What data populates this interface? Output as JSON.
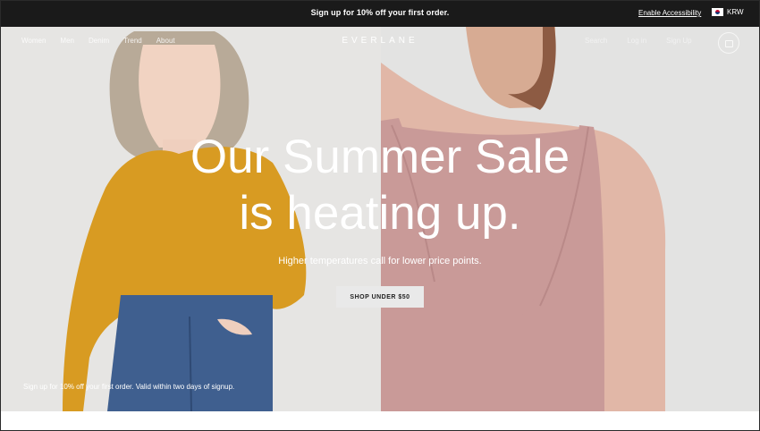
{
  "promo": {
    "message": "Sign up for 10% off your first order.",
    "accessibility_link": "Enable Accessibility",
    "currency": "KRW"
  },
  "nav": {
    "left_items": [
      "Women",
      "Men",
      "Denim",
      "Trend",
      "About"
    ],
    "brand": "EVERLANE",
    "right_items": [
      "Search",
      "Log in",
      "Sign Up"
    ]
  },
  "hero": {
    "headline_line1": "Our Summer Sale",
    "headline_line2": "is heating up.",
    "subheadline": "Higher temperatures call for lower price points.",
    "cta_label": "SHOP UNDER $50",
    "disclaimer": "Sign up for 10% off your first order. Valid within two days of signup."
  },
  "colors": {
    "promo_bg": "#1a1a1a",
    "cta_bg": "#e9e9e9",
    "sweater": "#d89b22",
    "denim": "#3f5f8f",
    "tank": "#c99a98"
  }
}
